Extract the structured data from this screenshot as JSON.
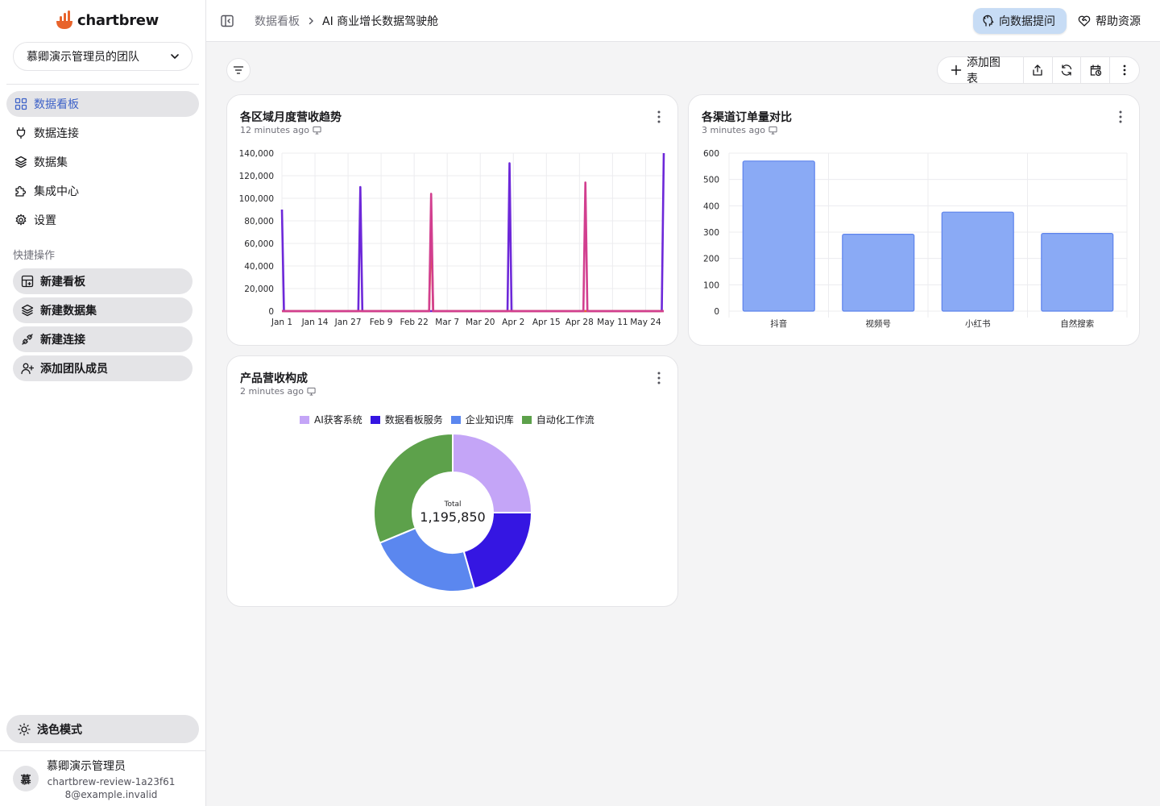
{
  "app": {
    "brand": "chartbrew"
  },
  "sidebar": {
    "team": "慕卿演示管理员的团队",
    "nav": [
      {
        "label": "数据看板",
        "icon": "grid-icon",
        "active": true
      },
      {
        "label": "数据连接",
        "icon": "plug-icon",
        "active": false
      },
      {
        "label": "数据集",
        "icon": "layers-icon",
        "active": false
      },
      {
        "label": "集成中心",
        "icon": "puzzle-icon",
        "active": false
      },
      {
        "label": "设置",
        "icon": "gear-icon",
        "active": false
      }
    ],
    "quick_title": "快捷操作",
    "quick": [
      {
        "label": "新建看板",
        "icon": "grid-plus-icon"
      },
      {
        "label": "新建数据集",
        "icon": "layers-plus-icon"
      },
      {
        "label": "新建连接",
        "icon": "plug-plus-icon"
      },
      {
        "label": "添加团队成员",
        "icon": "user-plus-icon"
      }
    ],
    "theme_label": "浅色模式",
    "user": {
      "initial": "慕",
      "name": "慕卿演示管理员",
      "email": "chartbrew-review-1a23f618@example.invalid"
    }
  },
  "header": {
    "breadcrumb": [
      "数据看板",
      "AI 商业增长数据驾驶舱"
    ],
    "ask_label": "向数据提问",
    "help_label": "帮助资源"
  },
  "toolbar": {
    "add_chart_label": "添加图表"
  },
  "cards": {
    "line": {
      "title": "各区域月度营收趋势",
      "updated": "12 minutes ago"
    },
    "bar": {
      "title": "各渠道订单量对比",
      "updated": "3 minutes ago"
    },
    "donut": {
      "title": "产品营收构成",
      "updated": "2 minutes ago",
      "total_label": "Total",
      "total_value": "1,195,850"
    }
  },
  "colors": {
    "accent": "#3f63c8",
    "ask_bg": "#c7dcf5",
    "brand": "#e8632b"
  },
  "chart_data": [
    {
      "type": "line",
      "title": "各区域月度营收趋势",
      "x_ticks": [
        "Jan 1",
        "Jan 14",
        "Jan 27",
        "Feb 9",
        "Feb 22",
        "Mar 7",
        "Mar 20",
        "Apr 2",
        "Apr 15",
        "Apr 28",
        "May 11",
        "May 24"
      ],
      "ylim": [
        0,
        140000
      ],
      "y_ticks": [
        0,
        20000,
        40000,
        60000,
        80000,
        100000,
        120000,
        140000
      ],
      "y_tick_labels": [
        "0",
        "20,000",
        "40,000",
        "60,000",
        "80,000",
        "100,000",
        "120,000",
        "140,000"
      ],
      "xlim": [
        "2025-01-01",
        "2025-06-01"
      ],
      "grid": true,
      "series": [
        {
          "color": "#6d28d9",
          "points": [
            [
              "2025-01-01",
              90000
            ],
            [
              "2025-02-01",
              110000
            ],
            [
              "2025-04-01",
              131000
            ],
            [
              "2025-06-01",
              140000
            ]
          ]
        },
        {
          "color": "#e8632b",
          "points": [
            [
              "2025-03-01",
              80000
            ]
          ]
        },
        {
          "color": "#d23f8f",
          "points": [
            [
              "2025-03-01",
              104000
            ],
            [
              "2025-05-01",
              114000
            ]
          ]
        }
      ]
    },
    {
      "type": "bar",
      "title": "各渠道订单量对比",
      "categories": [
        "抖音",
        "视频号",
        "小红书",
        "自然搜索"
      ],
      "values": [
        570,
        292,
        376,
        295
      ],
      "ylim": [
        0,
        600
      ],
      "y_ticks": [
        0,
        100,
        200,
        300,
        400,
        500,
        600
      ],
      "grid": true,
      "color": "#8aaaf5"
    },
    {
      "type": "pie",
      "title": "产品营收构成",
      "legend_position": "top",
      "total": 1195850,
      "slices": [
        {
          "name": "AI获客系统",
          "value": 299000,
          "color": "#c4a5f7"
        },
        {
          "name": "数据看板服务",
          "value": 246000,
          "color": "#3516e2"
        },
        {
          "name": "企业知识库",
          "value": 277000,
          "color": "#5b87ef"
        },
        {
          "name": "自动化工作流",
          "value": 373850,
          "color": "#5da14b"
        }
      ]
    }
  ]
}
